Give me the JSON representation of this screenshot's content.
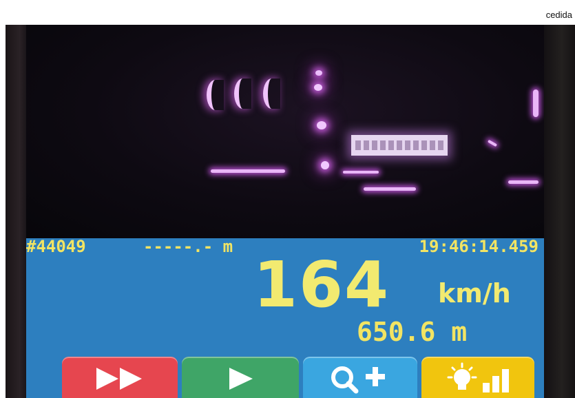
{
  "credit": "cedida",
  "hud": {
    "record_id": "#44049",
    "gps_distance": "-----.- m",
    "timestamp": "19:46:14.459",
    "speed_value": "164",
    "speed_unit": "km/h",
    "distance": "650.6 m"
  },
  "buttons": [
    {
      "name": "fast-forward",
      "icon": "fast-forward-icon",
      "color": "#e6464f"
    },
    {
      "name": "play",
      "icon": "play-icon",
      "color": "#3fa567"
    },
    {
      "name": "zoom-in",
      "icon": "zoom-in-icon",
      "color": "#3aa6e0"
    },
    {
      "name": "brightness",
      "icon": "brightness-bars-icon",
      "color": "#f1c50e"
    }
  ],
  "colors": {
    "hud_background": "#2d7fbf",
    "hud_text": "#f2e463"
  }
}
